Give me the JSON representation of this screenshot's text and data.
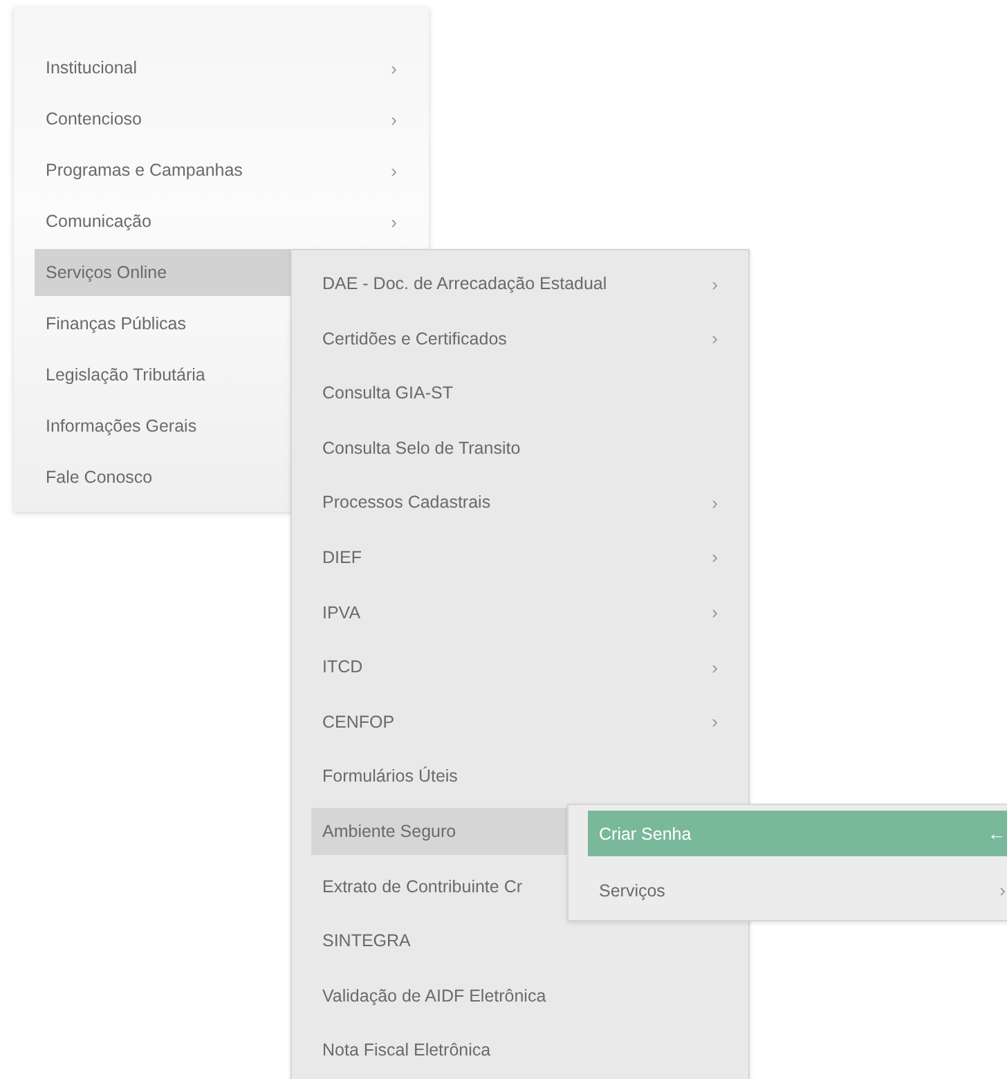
{
  "menu": {
    "items": [
      {
        "label": "Institucional",
        "selected": false,
        "marker": "›"
      },
      {
        "label": "Contencioso",
        "selected": false,
        "marker": "›"
      },
      {
        "label": "Programas e Campanhas",
        "selected": false,
        "marker": "›"
      },
      {
        "label": "Comunicação",
        "selected": false,
        "marker": "›"
      },
      {
        "label": "Serviços Online",
        "selected": true,
        "children": [
          {
            "label": "DAE - Doc. de Arrecadação Estadual",
            "selected": false,
            "marker": "›"
          },
          {
            "label": "Certidões e Certificados",
            "selected": false,
            "marker": "›"
          },
          {
            "label": "Consulta GIA-ST",
            "selected": false
          },
          {
            "label": "Consulta Selo de Transito",
            "selected": false
          },
          {
            "label": "Processos Cadastrais",
            "selected": false,
            "marker": "›"
          },
          {
            "label": "DIEF",
            "selected": false,
            "marker": "›"
          },
          {
            "label": "IPVA",
            "selected": false,
            "marker": "›"
          },
          {
            "label": "ITCD",
            "selected": false,
            "marker": "›"
          },
          {
            "label": "CENFOP",
            "selected": false,
            "marker": "›"
          },
          {
            "label": "Formulários Úteis",
            "selected": false
          },
          {
            "label": "Ambiente Seguro",
            "selected": true,
            "children": [
              {
                "label": "Criar Senha",
                "selected": true,
                "marker": "←"
              },
              {
                "label": "Serviços",
                "selected": false,
                "marker": "›"
              }
            ]
          },
          {
            "label": "Extrato de Contribuinte Cr",
            "selected": false
          },
          {
            "label": "SINTEGRA",
            "selected": false
          },
          {
            "label": "Validação de AIDF Eletrônica",
            "selected": false
          },
          {
            "label": "Nota Fiscal Eletrônica",
            "selected": false
          }
        ]
      },
      {
        "label": "Finanças Públicas",
        "selected": false
      },
      {
        "label": "Legislação Tributária",
        "selected": false
      },
      {
        "label": "Informações Gerais",
        "selected": false
      },
      {
        "label": "Fale Conosco",
        "selected": false
      }
    ]
  }
}
